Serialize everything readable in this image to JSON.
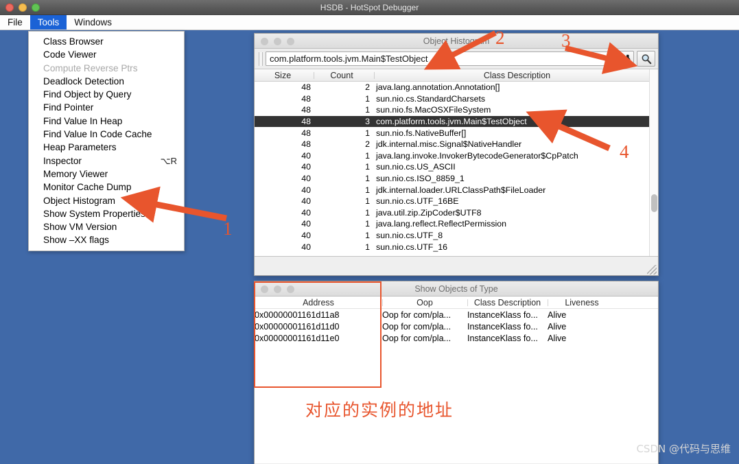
{
  "window": {
    "title": "HSDB - HotSpot Debugger",
    "traffic_lights": [
      "close",
      "minimize",
      "zoom"
    ]
  },
  "menubar": {
    "items": [
      {
        "label": "File",
        "active": false
      },
      {
        "label": "Tools",
        "active": true
      },
      {
        "label": "Windows",
        "active": false
      }
    ]
  },
  "tools_menu": {
    "items": [
      {
        "label": "Class Browser",
        "disabled": false,
        "shortcut": ""
      },
      {
        "label": "Code Viewer",
        "disabled": false,
        "shortcut": ""
      },
      {
        "label": "Compute Reverse Ptrs",
        "disabled": true,
        "shortcut": ""
      },
      {
        "label": "Deadlock Detection",
        "disabled": false,
        "shortcut": ""
      },
      {
        "label": "Find Object by Query",
        "disabled": false,
        "shortcut": ""
      },
      {
        "label": "Find Pointer",
        "disabled": false,
        "shortcut": ""
      },
      {
        "label": "Find Value In Heap",
        "disabled": false,
        "shortcut": ""
      },
      {
        "label": "Find Value In Code Cache",
        "disabled": false,
        "shortcut": ""
      },
      {
        "label": "Heap Parameters",
        "disabled": false,
        "shortcut": ""
      },
      {
        "label": "Inspector",
        "disabled": false,
        "shortcut": "⌥R"
      },
      {
        "label": "Memory Viewer",
        "disabled": false,
        "shortcut": ""
      },
      {
        "label": "Monitor Cache Dump",
        "disabled": false,
        "shortcut": ""
      },
      {
        "label": "Object Histogram",
        "disabled": false,
        "shortcut": ""
      },
      {
        "label": "Show System Properties",
        "disabled": false,
        "shortcut": ""
      },
      {
        "label": "Show VM Version",
        "disabled": false,
        "shortcut": ""
      },
      {
        "label": "Show –XX flags",
        "disabled": false,
        "shortcut": ""
      }
    ]
  },
  "histogram_window": {
    "title": "Object Histogram",
    "search_value": "com.platform.tools.jvm.Main$TestObject",
    "search_placeholder": "",
    "buttons": [
      {
        "icon": "binoculars-icon",
        "name": "find-button"
      },
      {
        "icon": "magnifier-icon",
        "name": "search-button"
      }
    ],
    "columns": [
      "Size",
      "Count",
      "Class Description"
    ],
    "rows": [
      {
        "size": "48",
        "count": "2",
        "desc": "java.lang.annotation.Annotation[]",
        "selected": false
      },
      {
        "size": "48",
        "count": "1",
        "desc": "sun.nio.cs.StandardCharsets",
        "selected": false
      },
      {
        "size": "48",
        "count": "1",
        "desc": "sun.nio.fs.MacOSXFileSystem",
        "selected": false
      },
      {
        "size": "48",
        "count": "3",
        "desc": "com.platform.tools.jvm.Main$TestObject",
        "selected": true
      },
      {
        "size": "48",
        "count": "1",
        "desc": "sun.nio.fs.NativeBuffer[]",
        "selected": false
      },
      {
        "size": "48",
        "count": "2",
        "desc": "jdk.internal.misc.Signal$NativeHandler",
        "selected": false
      },
      {
        "size": "40",
        "count": "1",
        "desc": "java.lang.invoke.InvokerBytecodeGenerator$CpPatch",
        "selected": false
      },
      {
        "size": "40",
        "count": "1",
        "desc": "sun.nio.cs.US_ASCII",
        "selected": false
      },
      {
        "size": "40",
        "count": "1",
        "desc": "sun.nio.cs.ISO_8859_1",
        "selected": false
      },
      {
        "size": "40",
        "count": "1",
        "desc": "jdk.internal.loader.URLClassPath$FileLoader",
        "selected": false
      },
      {
        "size": "40",
        "count": "1",
        "desc": "sun.nio.cs.UTF_16BE",
        "selected": false
      },
      {
        "size": "40",
        "count": "1",
        "desc": "java.util.zip.ZipCoder$UTF8",
        "selected": false
      },
      {
        "size": "40",
        "count": "1",
        "desc": "java.lang.reflect.ReflectPermission",
        "selected": false
      },
      {
        "size": "40",
        "count": "1",
        "desc": "sun.nio.cs.UTF_8",
        "selected": false
      },
      {
        "size": "40",
        "count": "1",
        "desc": "sun.nio.cs.UTF_16",
        "selected": false
      }
    ]
  },
  "objects_window": {
    "title": "Show Objects of Type",
    "columns": [
      "Address",
      "Oop",
      "Class Description",
      "Liveness"
    ],
    "rows": [
      {
        "address": "0x00000001161d11a8",
        "oop": "Oop for com/pla...",
        "cls": "InstanceKlass fo...",
        "liveness": "Alive"
      },
      {
        "address": "0x00000001161d11d0",
        "oop": "Oop for com/pla...",
        "cls": "InstanceKlass fo...",
        "liveness": "Alive"
      },
      {
        "address": "0x00000001161d11e0",
        "oop": "Oop for com/pla...",
        "cls": "InstanceKlass fo...",
        "liveness": "Alive"
      }
    ]
  },
  "annotations": {
    "markers": [
      {
        "number": "1",
        "target": "Object Histogram menu item"
      },
      {
        "number": "2",
        "target": "class name search field"
      },
      {
        "number": "3",
        "target": "binoculars find button"
      },
      {
        "number": "4",
        "target": "selected histogram row"
      }
    ],
    "note_cn": "对应的实例的地址",
    "accent_color": "#e8552d"
  },
  "watermark": {
    "text": "CSDN @代码与思维"
  },
  "colors": {
    "desktop": "#4069a8",
    "menu_highlight": "#1a62d6",
    "row_selected": "#333333",
    "annotation": "#e8552d"
  }
}
